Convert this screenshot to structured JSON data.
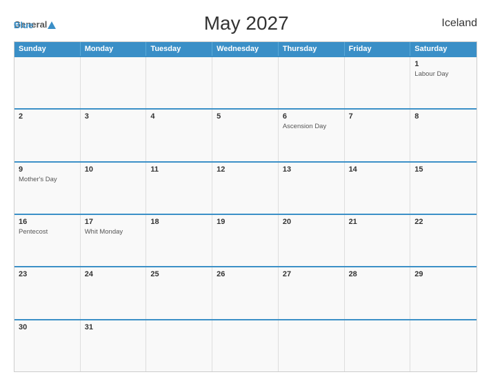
{
  "header": {
    "logo_general": "General",
    "logo_blue": "Blue",
    "title": "May 2027",
    "country": "Iceland"
  },
  "calendar": {
    "weekdays": [
      "Sunday",
      "Monday",
      "Tuesday",
      "Wednesday",
      "Thursday",
      "Friday",
      "Saturday"
    ],
    "rows": [
      [
        {
          "day": "",
          "event": ""
        },
        {
          "day": "",
          "event": ""
        },
        {
          "day": "",
          "event": ""
        },
        {
          "day": "",
          "event": ""
        },
        {
          "day": "",
          "event": ""
        },
        {
          "day": "",
          "event": ""
        },
        {
          "day": "1",
          "event": "Labour Day"
        }
      ],
      [
        {
          "day": "2",
          "event": ""
        },
        {
          "day": "3",
          "event": ""
        },
        {
          "day": "4",
          "event": ""
        },
        {
          "day": "5",
          "event": ""
        },
        {
          "day": "6",
          "event": "Ascension Day"
        },
        {
          "day": "7",
          "event": ""
        },
        {
          "day": "8",
          "event": ""
        }
      ],
      [
        {
          "day": "9",
          "event": "Mother's Day"
        },
        {
          "day": "10",
          "event": ""
        },
        {
          "day": "11",
          "event": ""
        },
        {
          "day": "12",
          "event": ""
        },
        {
          "day": "13",
          "event": ""
        },
        {
          "day": "14",
          "event": ""
        },
        {
          "day": "15",
          "event": ""
        }
      ],
      [
        {
          "day": "16",
          "event": "Pentecost"
        },
        {
          "day": "17",
          "event": "Whit Monday"
        },
        {
          "day": "18",
          "event": ""
        },
        {
          "day": "19",
          "event": ""
        },
        {
          "day": "20",
          "event": ""
        },
        {
          "day": "21",
          "event": ""
        },
        {
          "day": "22",
          "event": ""
        }
      ],
      [
        {
          "day": "23",
          "event": ""
        },
        {
          "day": "24",
          "event": ""
        },
        {
          "day": "25",
          "event": ""
        },
        {
          "day": "26",
          "event": ""
        },
        {
          "day": "27",
          "event": ""
        },
        {
          "day": "28",
          "event": ""
        },
        {
          "day": "29",
          "event": ""
        }
      ],
      [
        {
          "day": "30",
          "event": ""
        },
        {
          "day": "31",
          "event": ""
        },
        {
          "day": "",
          "event": ""
        },
        {
          "day": "",
          "event": ""
        },
        {
          "day": "",
          "event": ""
        },
        {
          "day": "",
          "event": ""
        },
        {
          "day": "",
          "event": ""
        }
      ]
    ]
  }
}
